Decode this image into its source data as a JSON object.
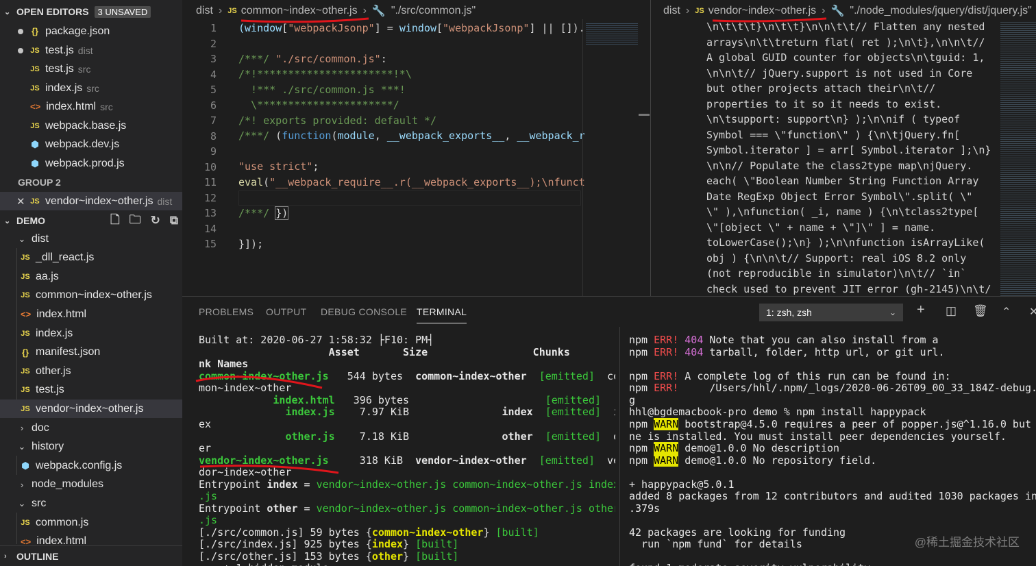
{
  "sidebar": {
    "open_editors": {
      "title": "OPEN EDITORS",
      "badge": "3 UNSAVED"
    },
    "editors": [
      {
        "name": "package.json",
        "hint": "",
        "icon": "json-icon",
        "dirty": true
      },
      {
        "name": "test.js",
        "hint": "dist",
        "icon": "js-icon",
        "dirty": true
      },
      {
        "name": "test.js",
        "hint": "src",
        "icon": "js-icon",
        "dirty": false
      },
      {
        "name": "index.js",
        "hint": "src",
        "icon": "js-icon",
        "dirty": false
      },
      {
        "name": "index.html",
        "hint": "src",
        "icon": "html-icon",
        "dirty": false
      },
      {
        "name": "webpack.base.js",
        "hint": "",
        "icon": "js-icon",
        "dirty": false
      },
      {
        "name": "webpack.dev.js",
        "hint": "",
        "icon": "webpack-icon",
        "dirty": false
      },
      {
        "name": "webpack.prod.js",
        "hint": "",
        "icon": "webpack-icon",
        "dirty": false
      }
    ],
    "group2": {
      "title": "GROUP 2",
      "file": "vendor~index~other.js",
      "hint": "dist"
    },
    "demo_title": "DEMO",
    "tree": [
      {
        "name": "dist",
        "type": "folder-open"
      },
      {
        "name": "_dll_react.js",
        "type": "js"
      },
      {
        "name": "aa.js",
        "type": "js"
      },
      {
        "name": "common~index~other.js",
        "type": "js"
      },
      {
        "name": "index.html",
        "type": "html"
      },
      {
        "name": "index.js",
        "type": "js"
      },
      {
        "name": "manifest.json",
        "type": "json"
      },
      {
        "name": "other.js",
        "type": "js"
      },
      {
        "name": "test.js",
        "type": "js"
      },
      {
        "name": "vendor~index~other.js",
        "type": "js"
      },
      {
        "name": "doc",
        "type": "folder-closed"
      },
      {
        "name": "history",
        "type": "folder-open"
      },
      {
        "name": "webpack.config.js",
        "type": "webpack"
      },
      {
        "name": "node_modules",
        "type": "folder-closed"
      },
      {
        "name": "src",
        "type": "folder-open"
      },
      {
        "name": "common.js",
        "type": "js"
      },
      {
        "name": "index.html",
        "type": "html"
      }
    ],
    "outline": "OUTLINE"
  },
  "editor1": {
    "crumb_root": "dist",
    "crumb_file": "common~index~other.js",
    "crumb_symbol": "\"./src/common.js\"",
    "line_numbers": [
      "1",
      "2",
      "3",
      "4",
      "5",
      "6",
      "7",
      "8",
      "9",
      "10",
      "11",
      "12",
      "13",
      "14",
      "15"
    ]
  },
  "editor2": {
    "crumb_root": "dist",
    "crumb_file": "vendor~index~other.js",
    "crumb_symbol": "\"./node_modules/jquery/dist/jquery.js\"",
    "lines": [
      "\\n\\t\\t\\t}\\n\\t\\t}\\n\\n\\t\\t// Flatten any nested",
      "arrays\\n\\t\\treturn flat( ret );\\n\\t},\\n\\n\\t//",
      "A global GUID counter for objects\\n\\tguid: 1,",
      "\\n\\n\\t// jQuery.support is not used in Core",
      "but other projects attach their\\n\\t//",
      "properties to it so it needs to exist.",
      "\\n\\tsupport: support\\n} );\\n\\nif ( typeof",
      "Symbol === \\\"function\\\" ) {\\n\\tjQuery.fn[",
      "Symbol.iterator ] = arr[ Symbol.iterator ];\\n}",
      "\\n\\n// Populate the class2type map\\njQuery.",
      "each( \\\"Boolean Number String Function Array",
      "Date RegExp Object Error Symbol\\\".split( \\\"",
      "\\\" ),\\nfunction( _i, name ) {\\n\\tclass2type[",
      "\\\"[object \\\" + name + \\\"]\\\" ] = name.",
      "toLowerCase();\\n} );\\n\\nfunction isArrayLike(",
      "obj ) {\\n\\n\\t// Support: real iOS 8.2 only",
      "(not reproducible in simulator)\\n\\t// `in`",
      "check used to prevent JIT error (gh-2145)\\n\\t/"
    ]
  },
  "panel": {
    "tabs": [
      "PROBLEMS",
      "OUTPUT",
      "DEBUG CONSOLE",
      "TERMINAL"
    ],
    "terminal_select": "1: zsh, zsh"
  },
  "watermark": "@稀土掘金技术社区",
  "colors": {
    "editor_bg": "#1e1e1e",
    "sidebar_bg": "#252526",
    "accent_yellow": "#e5e500",
    "accent_green": "#3bc73b",
    "annotation_red": "#e0151b"
  }
}
